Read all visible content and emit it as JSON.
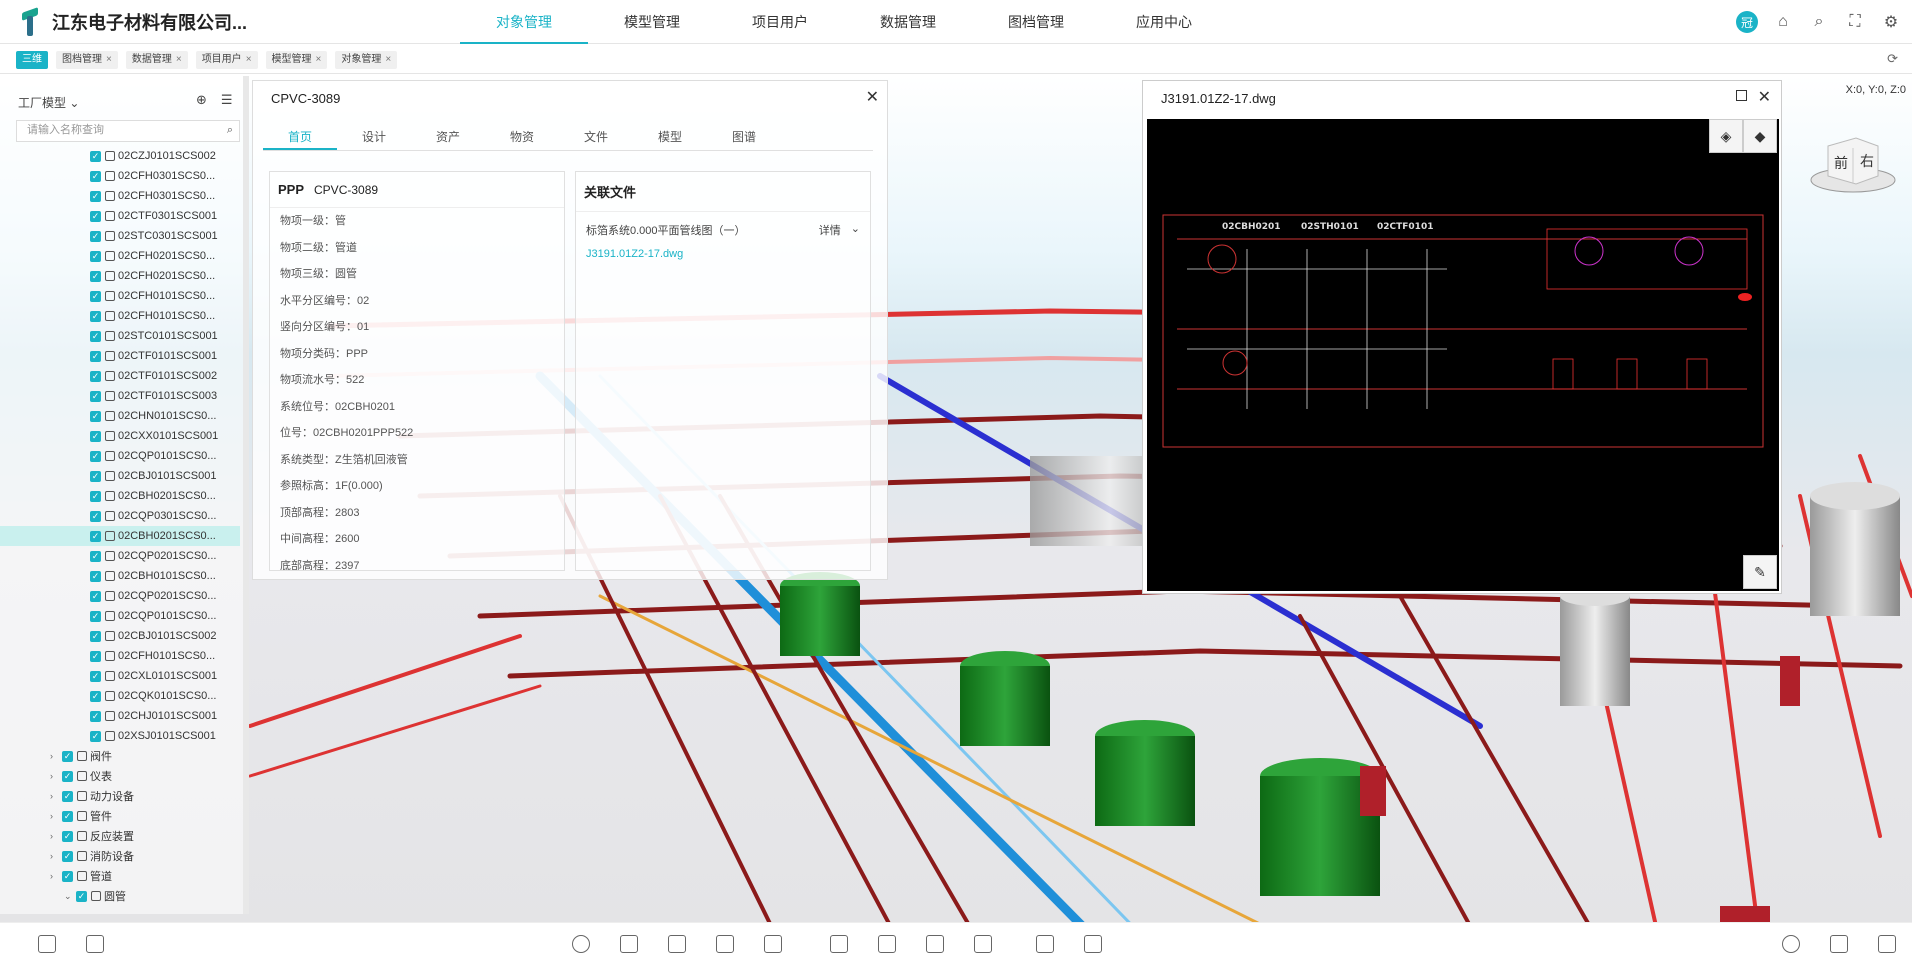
{
  "header": {
    "title": "江东电子材料有限公司...",
    "nav": [
      "对象管理",
      "模型管理",
      "项目用户",
      "数据管理",
      "图档管理",
      "应用中心"
    ],
    "active_nav": 0,
    "avatar_text": "冠"
  },
  "tabs": [
    {
      "label": "三维",
      "active": true
    },
    {
      "label": "图档管理",
      "active": false
    },
    {
      "label": "数据管理",
      "active": false
    },
    {
      "label": "项目用户",
      "active": false
    },
    {
      "label": "模型管理",
      "active": false
    },
    {
      "label": "对象管理",
      "active": false
    }
  ],
  "sidebar": {
    "title": "工厂模型",
    "search_placeholder": "请输入名称查询",
    "items": [
      "02CZJ0101SCS002",
      "02CFH0301SCS0...",
      "02CFH0301SCS0...",
      "02CTF0301SCS001",
      "02STC0301SCS001",
      "02CFH0201SCS0...",
      "02CFH0201SCS0...",
      "02CFH0101SCS0...",
      "02CFH0101SCS0...",
      "02STC0101SCS001",
      "02CTF0101SCS001",
      "02CTF0101SCS002",
      "02CTF0101SCS003",
      "02CHN0101SCS0...",
      "02CXX0101SCS001",
      "02CQP0101SCS0...",
      "02CBJ0101SCS001",
      "02CBH0201SCS0...",
      "02CQP0301SCS0...",
      "02CBH0201SCS0...",
      "02CQP0201SCS0...",
      "02CBH0101SCS0...",
      "02CQP0201SCS0...",
      "02CQP0101SCS0...",
      "02CBJ0101SCS002",
      "02CFH0101SCS0...",
      "02CXL0101SCS001",
      "02CQK0101SCS0...",
      "02CHJ0101SCS001",
      "02XSJ0101SCS001"
    ],
    "selected_index": 19,
    "groups": [
      "阀件",
      "仪表",
      "动力设备",
      "管件",
      "反应装置",
      "消防设备",
      "管道"
    ],
    "sub_item": "圆管"
  },
  "panel": {
    "title": "CPVC-3089",
    "tabs": [
      "首页",
      "设计",
      "资产",
      "物资",
      "文件",
      "模型",
      "图谱"
    ],
    "info_title": "PPP",
    "info_code": "CPVC-3089",
    "rows": [
      "物项一级：管",
      "物项二级：管道",
      "物项三级：圆管",
      "水平分区编号：02",
      "竖向分区编号：01",
      "物项分类码：PPP",
      "物项流水号：522",
      "系统位号：02CBH0201",
      "位号：02CBH0201PPP522",
      "系统类型：Z生箔机回液管",
      "参照标高：1F(0.000)",
      "顶部高程：2803",
      "中间高程：2600",
      "底部高程：2397"
    ],
    "related_title": "关联文件",
    "related_doc": "标箔系统0.000平面管线图（一）",
    "related_detail": "详情",
    "related_file": "J3191.01Z2-17.dwg"
  },
  "drawing": {
    "title": "J3191.01Z2-17.dwg",
    "labels": [
      "02CBH0201",
      "02STH0101",
      "02CTF0101"
    ]
  },
  "coord": "X:0, Y:0, Z:0",
  "viewcube": {
    "front": "前",
    "right": "右"
  }
}
